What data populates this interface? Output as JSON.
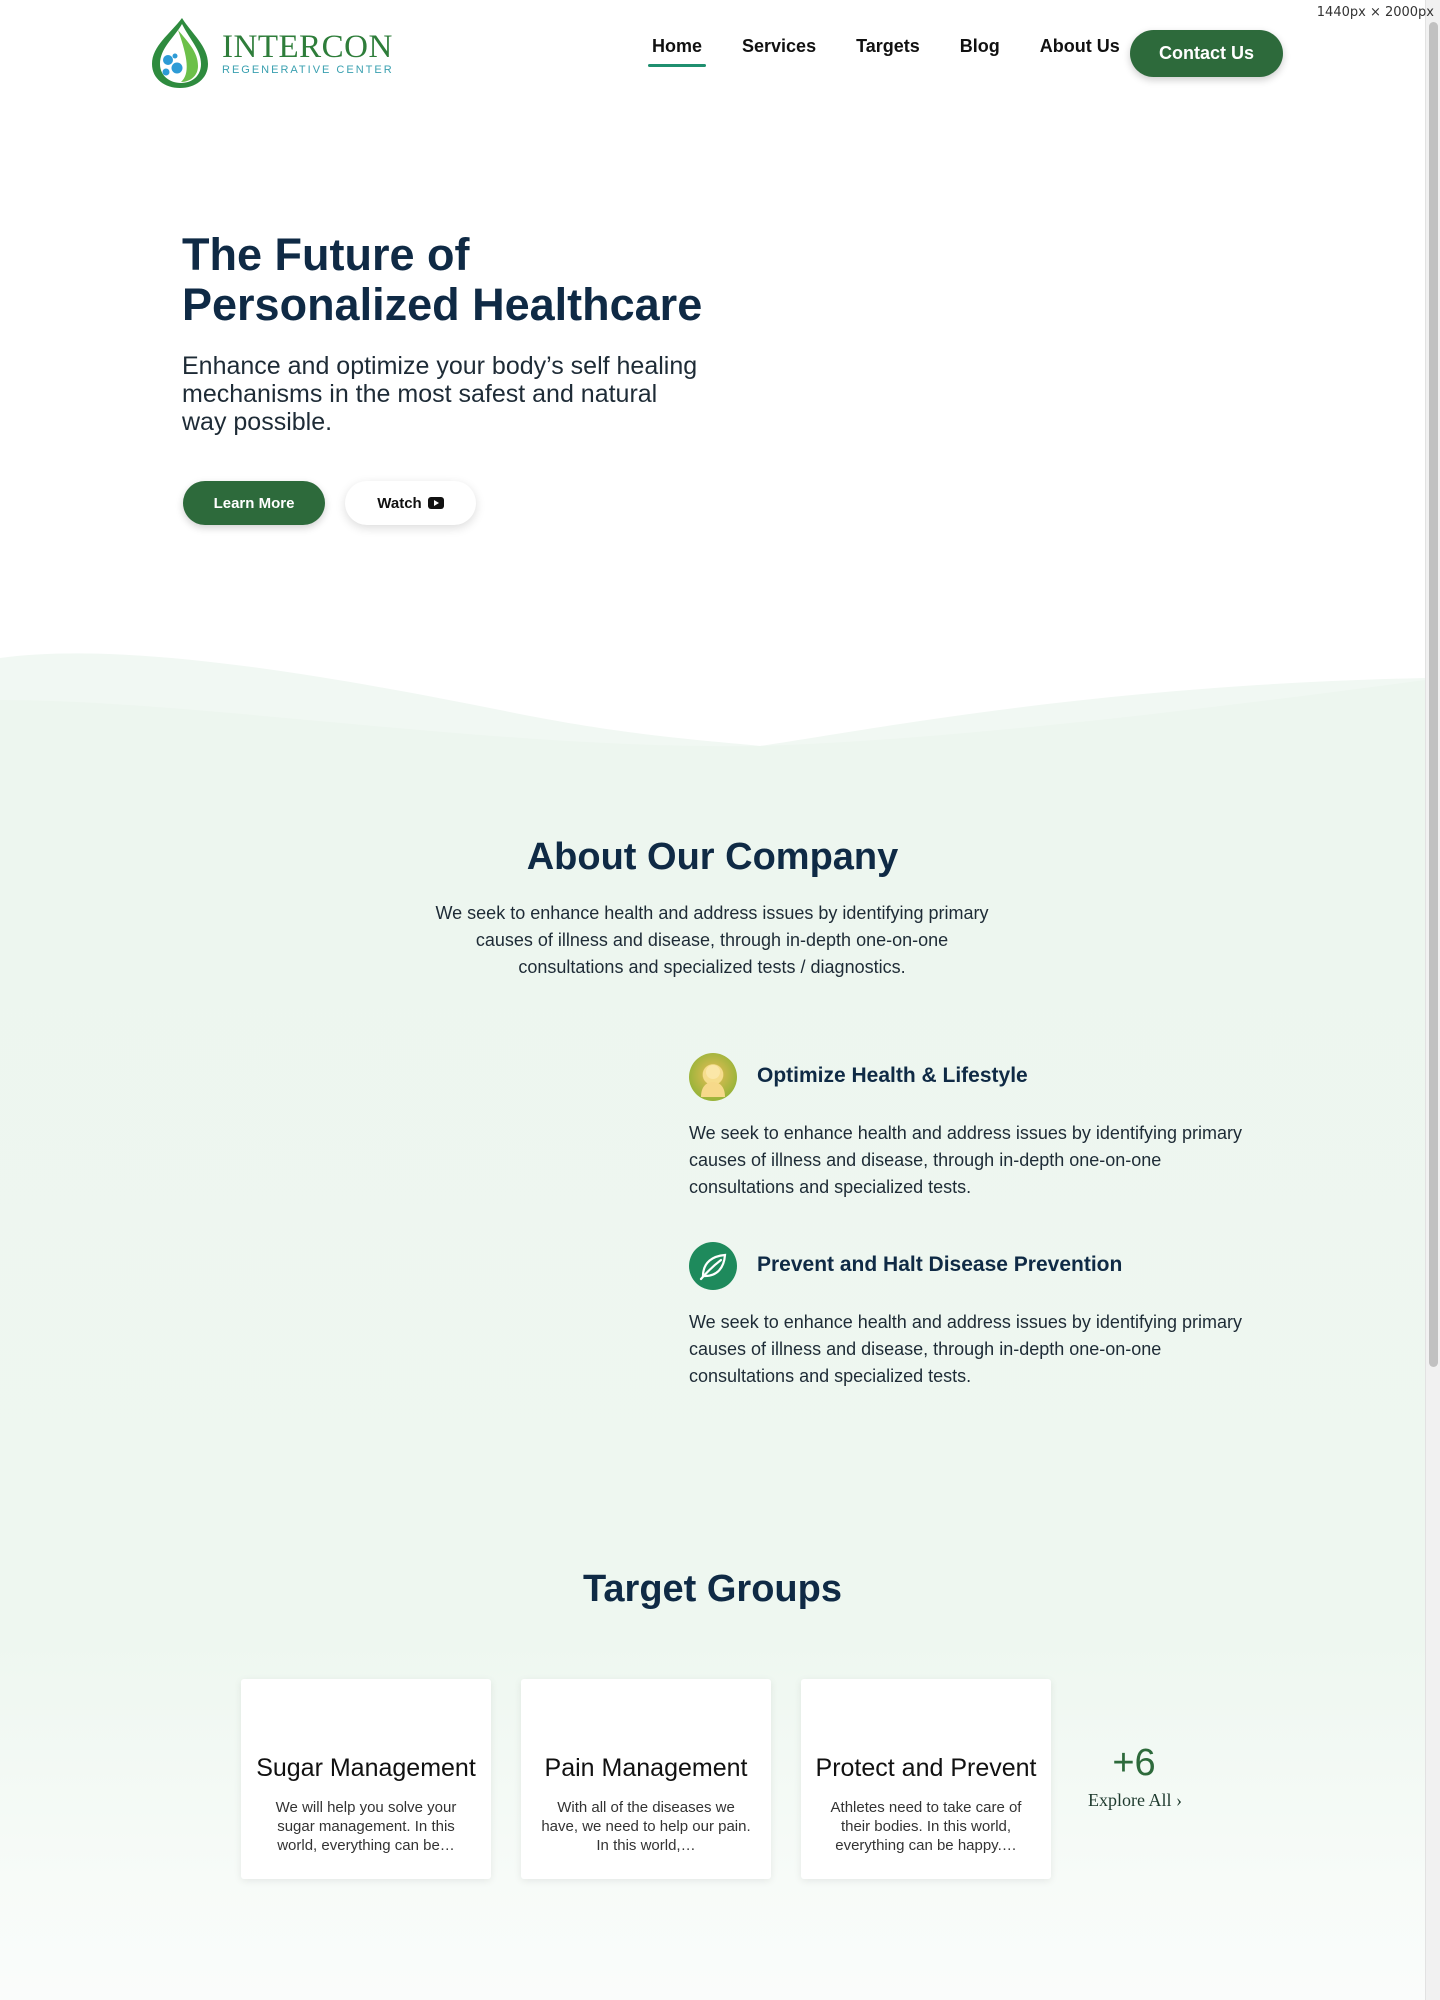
{
  "screen_label": "1440px × 2000px",
  "logo": {
    "name": "INTERCON",
    "sub": "REGENERATIVE CENTER"
  },
  "nav": {
    "items": [
      "Home",
      "Services",
      "Targets",
      "Blog",
      "About Us"
    ],
    "active": "Home",
    "contact_label": "Contact Us"
  },
  "hero": {
    "title": "The Future of Personalized Healthcare",
    "subtitle": "Enhance and optimize your body’s self healing mechanisms in the most safest and natural way possible.",
    "learn_more_label": "Learn More",
    "watch_label": "Watch"
  },
  "about": {
    "title": "About Our Company",
    "description": "We seek to enhance health and address issues by identifying primary causes of illness and disease, through in-depth one-on-one consultations and specialized tests / diagnostics.",
    "features": [
      {
        "title": "Optimize Health & Lifestyle",
        "text": "We seek to enhance health and address issues by identifying primary causes of illness and disease, through in-depth one-on-one consultations and specialized tests."
      },
      {
        "title": "Prevent and Halt Disease Prevention",
        "text": "We seek to enhance health and address issues by identifying primary causes of illness and disease, through in-depth one-on-one consultations and specialized tests."
      }
    ]
  },
  "targets": {
    "title": "Target Groups",
    "cards": [
      {
        "title": "Sugar Management",
        "text": "We will help you solve your sugar management. In this world, everything can be…"
      },
      {
        "title": "Pain Management",
        "text": "With all of the diseases we have, we need to help our pain. In this world,…"
      },
      {
        "title": "Protect and Prevent",
        "text": "Athletes need to take care of their bodies. In this world, everything can be happy.…"
      }
    ],
    "more_count": "+6",
    "explore_label": "Explore All ›"
  },
  "colors": {
    "brand_green": "#2d6a3b",
    "heading_navy": "#0f2a45",
    "section_bg": "#edf6ef",
    "accent_teal": "#1f8f6f"
  }
}
